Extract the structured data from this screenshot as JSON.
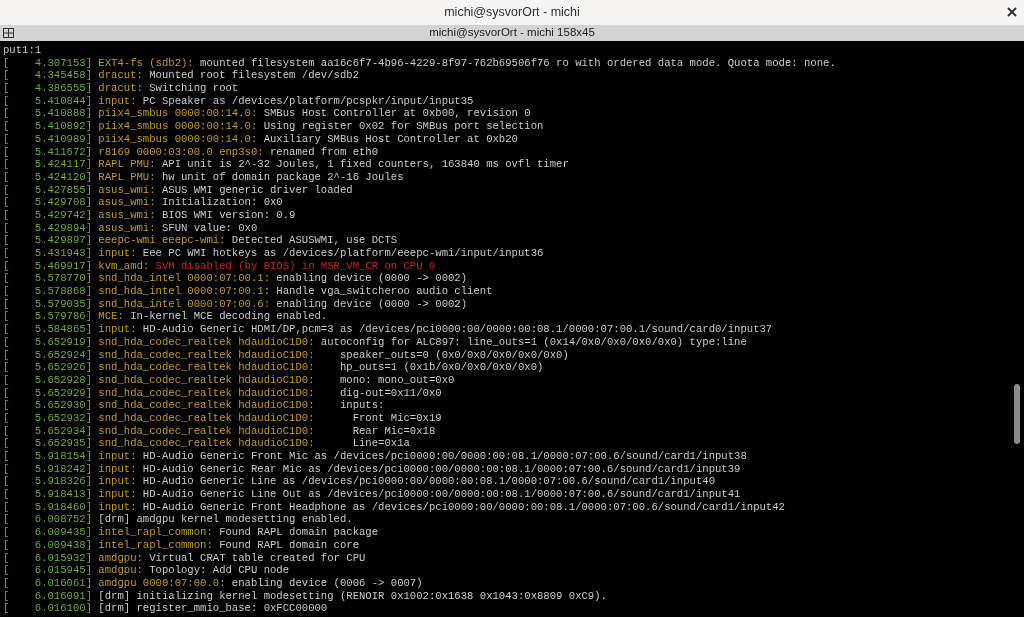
{
  "window": {
    "title": "michi@sysvorOrt - michi"
  },
  "tab": {
    "title": "michi@sysvorOrt - michi 158x45"
  },
  "lines": [
    {
      "message": "put1:1",
      "kind": "info"
    },
    {
      "timestamp": "[    4.307153]",
      "source": "EXT4-fs (sdb2):",
      "message": "mounted filesystem aa16c6f7-4b96-4229-8f97-762b69506f76 ro with ordered data mode. Quota mode: none.",
      "kind": "info"
    },
    {
      "timestamp": "[    4.345458]",
      "source": "dracut:",
      "message": "Mounted root filesystem /dev/sdb2",
      "kind": "info"
    },
    {
      "timestamp": "[    4.386555]",
      "source": "dracut:",
      "message": "Switching root",
      "kind": "info"
    },
    {
      "timestamp": "[    5.410844]",
      "source": "input:",
      "message": "PC Speaker as /devices/platform/pcspkr/input/input35",
      "kind": "info"
    },
    {
      "timestamp": "[    5.410888]",
      "source": "piix4_smbus 0000:00:14.0:",
      "message": "SMBus Host Controller at 0xb00, revision 0",
      "kind": "info"
    },
    {
      "timestamp": "[    5.410892]",
      "source": "piix4_smbus 0000:00:14.0:",
      "message": "Using register 0x02 for SMBus port selection",
      "kind": "info"
    },
    {
      "timestamp": "[    5.410989]",
      "source": "piix4_smbus 0000:00:14.0:",
      "message": "Auxiliary SMBus Host Controller at 0xb20",
      "kind": "info"
    },
    {
      "timestamp": "[    5.411672]",
      "source": "r8169 0000:03:00.0 enp3s0:",
      "message": "renamed from eth0",
      "kind": "info"
    },
    {
      "timestamp": "[    5.424117]",
      "source": "RAPL PMU:",
      "message": "API unit is 2^-32 Joules, 1 fixed counters, 163840 ms ovfl timer",
      "kind": "info"
    },
    {
      "timestamp": "[    5.424120]",
      "source": "RAPL PMU:",
      "message": "hw unit of domain package 2^-16 Joules",
      "kind": "info"
    },
    {
      "timestamp": "[    5.427855]",
      "source": "asus_wmi:",
      "message": "ASUS WMI generic driver loaded",
      "kind": "info"
    },
    {
      "timestamp": "[    5.429708]",
      "source": "asus_wmi:",
      "message": "Initialization: 0x0",
      "kind": "info"
    },
    {
      "timestamp": "[    5.429742]",
      "source": "asus_wmi:",
      "message": "BIOS WMI version: 0.9",
      "kind": "info"
    },
    {
      "timestamp": "[    5.429894]",
      "source": "asus_wmi:",
      "message": "SFUN value: 0x0",
      "kind": "info"
    },
    {
      "timestamp": "[    5.429897]",
      "source": "eeepc-wmi eeepc-wmi:",
      "message": "Detected ASUSWMI, use DCTS",
      "kind": "info"
    },
    {
      "timestamp": "[    5.431943]",
      "source": "input:",
      "message": "Eee PC WMI hotkeys as /devices/platform/eeepc-wmi/input/input36",
      "kind": "info"
    },
    {
      "timestamp": "[    5.469917]",
      "source": "kvm_amd:",
      "message": "SVM disabled (by BIOS) in MSR_VM_CR on CPU 0",
      "kind": "error"
    },
    {
      "timestamp": "[    5.578770]",
      "source": "snd_hda_intel 0000:07:00.1:",
      "message": "enabling device (0000 -> 0002)",
      "kind": "info"
    },
    {
      "timestamp": "[    5.578868]",
      "source": "snd_hda_intel 0000:07:00.1:",
      "message": "Handle vga_switcheroo audio client",
      "kind": "info"
    },
    {
      "timestamp": "[    5.579035]",
      "source": "snd_hda_intel 0000:07:00.6:",
      "message": "enabling device (0000 -> 0002)",
      "kind": "info"
    },
    {
      "timestamp": "[    5.579786]",
      "source": "MCE:",
      "message": "In-kernel MCE decoding enabled.",
      "kind": "info"
    },
    {
      "timestamp": "[    5.584865]",
      "source": "input:",
      "message": "HD-Audio Generic HDMI/DP,pcm=3 as /devices/pci0000:00/0000:00:08.1/0000:07:00.1/sound/card0/input37",
      "kind": "info"
    },
    {
      "timestamp": "[    5.652919]",
      "source": "snd_hda_codec_realtek hdaudioC1D0:",
      "message": "autoconfig for ALC897: line_outs=1 (0x14/0x0/0x0/0x0/0x0) type:line",
      "kind": "info"
    },
    {
      "timestamp": "[    5.652924]",
      "source": "snd_hda_codec_realtek hdaudioC1D0:",
      "message": "   speaker_outs=0 (0x0/0x0/0x0/0x0/0x0)",
      "kind": "info"
    },
    {
      "timestamp": "[    5.652926]",
      "source": "snd_hda_codec_realtek hdaudioC1D0:",
      "message": "   hp_outs=1 (0x1b/0x0/0x0/0x0/0x0)",
      "kind": "info"
    },
    {
      "timestamp": "[    5.652928]",
      "source": "snd_hda_codec_realtek hdaudioC1D0:",
      "message": "   mono: mono_out=0x0",
      "kind": "info"
    },
    {
      "timestamp": "[    5.652929]",
      "source": "snd_hda_codec_realtek hdaudioC1D0:",
      "message": "   dig-out=0x11/0x0",
      "kind": "info"
    },
    {
      "timestamp": "[    5.652930]",
      "source": "snd_hda_codec_realtek hdaudioC1D0:",
      "message": "   inputs:",
      "kind": "info"
    },
    {
      "timestamp": "[    5.652932]",
      "source": "snd_hda_codec_realtek hdaudioC1D0:",
      "message": "     Front Mic=0x19",
      "kind": "info"
    },
    {
      "timestamp": "[    5.652934]",
      "source": "snd_hda_codec_realtek hdaudioC1D0:",
      "message": "     Rear Mic=0x18",
      "kind": "info"
    },
    {
      "timestamp": "[    5.652935]",
      "source": "snd_hda_codec_realtek hdaudioC1D0:",
      "message": "     Line=0x1a",
      "kind": "info"
    },
    {
      "timestamp": "[    5.918154]",
      "source": "input:",
      "message": "HD-Audio Generic Front Mic as /devices/pci0000:00/0000:00:08.1/0000:07:00.6/sound/card1/input38",
      "kind": "info"
    },
    {
      "timestamp": "[    5.918242]",
      "source": "input:",
      "message": "HD-Audio Generic Rear Mic as /devices/pci0000:00/0000:00:08.1/0000:07:00.6/sound/card1/input39",
      "kind": "info"
    },
    {
      "timestamp": "[    5.918326]",
      "source": "input:",
      "message": "HD-Audio Generic Line as /devices/pci0000:00/0000:00:08.1/0000:07:00.6/sound/card1/input40",
      "kind": "info"
    },
    {
      "timestamp": "[    5.918413]",
      "source": "input:",
      "message": "HD-Audio Generic Line Out as /devices/pci0000:00/0000:00:08.1/0000:07:00.6/sound/card1/input41",
      "kind": "info"
    },
    {
      "timestamp": "[    5.918460]",
      "source": "input:",
      "message": "HD-Audio Generic Front Headphone as /devices/pci0000:00/0000:00:08.1/0000:07:00.6/sound/card1/input42",
      "kind": "info"
    },
    {
      "timestamp": "[    6.008752]",
      "message": "[drm] amdgpu kernel modesetting enabled.",
      "kind": "info"
    },
    {
      "timestamp": "[    6.009435]",
      "source": "intel_rapl_common:",
      "message": "Found RAPL domain package",
      "kind": "info"
    },
    {
      "timestamp": "[    6.009438]",
      "source": "intel_rapl_common:",
      "message": "Found RAPL domain core",
      "kind": "info"
    },
    {
      "timestamp": "[    6.015932]",
      "source": "amdgpu:",
      "message": "Virtual CRAT table created for CPU",
      "kind": "info"
    },
    {
      "timestamp": "[    6.015945]",
      "source": "amdgpu:",
      "message": "Topology: Add CPU node",
      "kind": "info"
    },
    {
      "timestamp": "[    6.016061]",
      "source": "amdgpu 0000:07:00.0:",
      "message": "enabling device (0006 -> 0007)",
      "kind": "info"
    },
    {
      "timestamp": "[    6.016091]",
      "message": "[drm] initializing kernel modesetting (RENOIR 0x1002:0x1638 0x1043:0x8809 0xC9).",
      "kind": "info"
    },
    {
      "timestamp": "[    6.016100]",
      "message": "[drm] register_mmio_base: 0xFCC00000",
      "kind": "info"
    }
  ]
}
